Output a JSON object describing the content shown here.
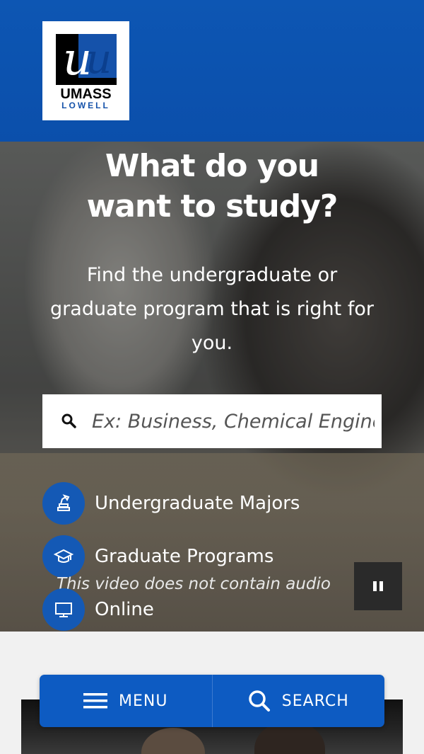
{
  "header": {
    "logo_top": "UMASS",
    "logo_bottom": "LOWELL",
    "logo_color": "#1552aa",
    "header_color": "#0d56b3"
  },
  "hero": {
    "title_line1": "What do you",
    "title_line2": "want to study?",
    "subtitle": "Find the undergraduate or graduate program that is right for you.",
    "search_placeholder": "Ex: Business, Chemical Engineering",
    "search_icon": "search-icon",
    "links": [
      {
        "label": "Undergraduate Majors",
        "icon": "lamp-books-icon"
      },
      {
        "label": "Graduate Programs",
        "icon": "graduation-cap-icon"
      },
      {
        "label": "Online",
        "icon": "monitor-icon"
      }
    ],
    "video_note": "This video does not contain audio",
    "pause_icon": "pause-icon",
    "accent_color": "#1459b5"
  },
  "bottom_nav": {
    "menu_label": "MENU",
    "search_label": "SEARCH",
    "color": "#0d5bc2"
  }
}
